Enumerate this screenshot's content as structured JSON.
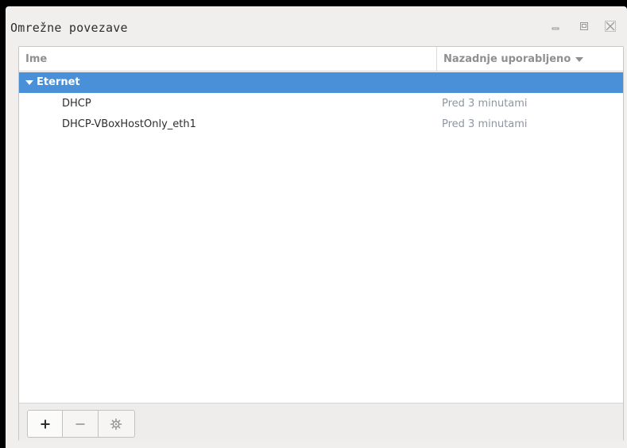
{
  "window": {
    "title": "Omrežne povezave",
    "controls": [
      "minimize-icon",
      "maximize-icon",
      "close-icon"
    ]
  },
  "list": {
    "columns": {
      "name": "Ime",
      "last_used": "Nazadnje uporabljeno"
    },
    "groups": [
      {
        "label": "Eternet",
        "expanded": true,
        "connections": [
          {
            "name": "DHCP",
            "last_used": "Pred 3 minutami"
          },
          {
            "name": "DHCP-VBoxHostOnly_eth1",
            "last_used": "Pred 3 minutami"
          }
        ]
      }
    ]
  },
  "toolbar": {
    "buttons": [
      "plus-icon",
      "minus-icon",
      "gear-icon"
    ]
  },
  "colors": {
    "selection": "#4a90d9",
    "secondary_text": "#8c96a3"
  }
}
